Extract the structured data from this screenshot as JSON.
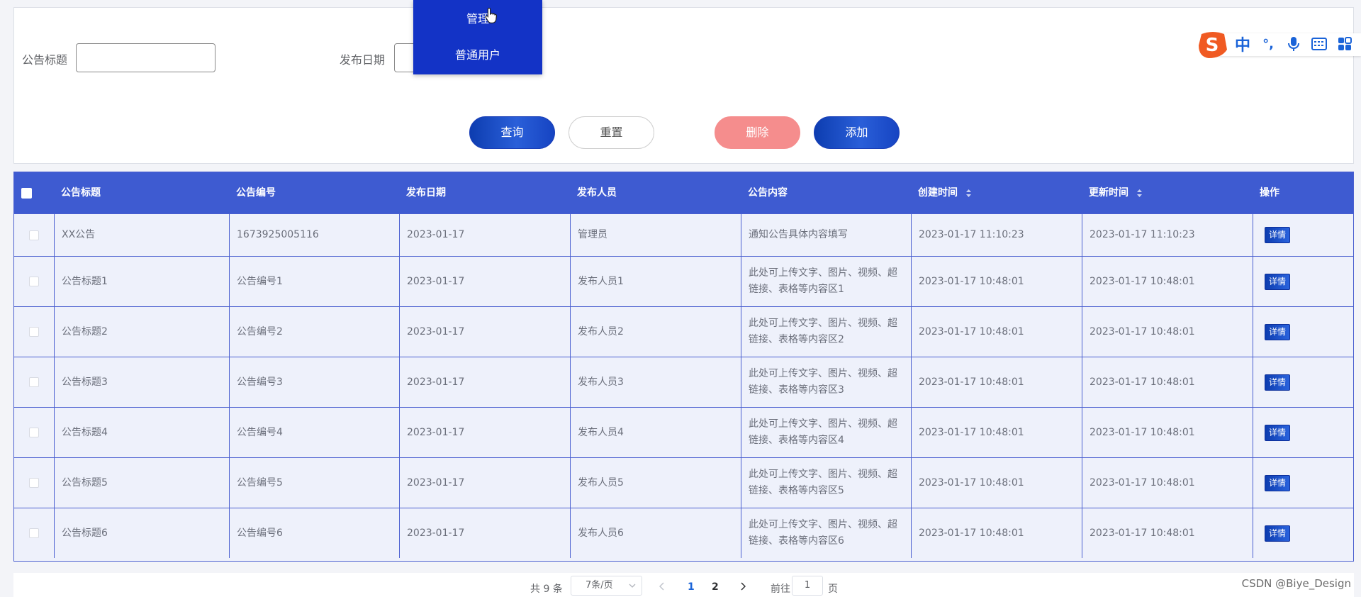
{
  "search": {
    "title_label": "公告标题",
    "title_value": "",
    "date_label": "发布日期",
    "date_value": ""
  },
  "buttons": {
    "query": "查询",
    "reset": "重置",
    "delete": "删除",
    "add": "添加"
  },
  "dropdown": {
    "items": [
      "管理员",
      "普通用户"
    ],
    "first_visible": "管理"
  },
  "ime": {
    "logo_letter": "S",
    "items": [
      "中",
      "°,",
      "mic-icon",
      "keyboard-icon",
      "grid-icon"
    ]
  },
  "table": {
    "headers": [
      "公告标题",
      "公告编号",
      "发布日期",
      "发布人员",
      "公告内容",
      "创建时间",
      "更新时间",
      "操作"
    ],
    "detail_label": "详情",
    "rows": [
      {
        "title": "XX公告",
        "number": "1673925005116",
        "date": "2023-01-17",
        "publisher": "管理员",
        "content": "通知公告具体内容填写",
        "created": "2023-01-17 11:10:23",
        "updated": "2023-01-17 11:10:23"
      },
      {
        "title": "公告标题1",
        "number": "公告编号1",
        "date": "2023-01-17",
        "publisher": "发布人员1",
        "content": "此处可上传文字、图片、视频、超链接、表格等内容区1",
        "created": "2023-01-17 10:48:01",
        "updated": "2023-01-17 10:48:01"
      },
      {
        "title": "公告标题2",
        "number": "公告编号2",
        "date": "2023-01-17",
        "publisher": "发布人员2",
        "content": "此处可上传文字、图片、视频、超链接、表格等内容区2",
        "created": "2023-01-17 10:48:01",
        "updated": "2023-01-17 10:48:01"
      },
      {
        "title": "公告标题3",
        "number": "公告编号3",
        "date": "2023-01-17",
        "publisher": "发布人员3",
        "content": "此处可上传文字、图片、视频、超链接、表格等内容区3",
        "created": "2023-01-17 10:48:01",
        "updated": "2023-01-17 10:48:01"
      },
      {
        "title": "公告标题4",
        "number": "公告编号4",
        "date": "2023-01-17",
        "publisher": "发布人员4",
        "content": "此处可上传文字、图片、视频、超链接、表格等内容区4",
        "created": "2023-01-17 10:48:01",
        "updated": "2023-01-17 10:48:01"
      },
      {
        "title": "公告标题5",
        "number": "公告编号5",
        "date": "2023-01-17",
        "publisher": "发布人员5",
        "content": "此处可上传文字、图片、视频、超链接、表格等内容区5",
        "created": "2023-01-17 10:48:01",
        "updated": "2023-01-17 10:48:01"
      },
      {
        "title": "公告标题6",
        "number": "公告编号6",
        "date": "2023-01-17",
        "publisher": "发布人员6",
        "content": "此处可上传文字、图片、视频、超链接、表格等内容区6",
        "created": "2023-01-17 10:48:01",
        "updated": "2023-01-17 10:48:01"
      }
    ]
  },
  "pager": {
    "total": "共 9 条",
    "page_size": "7条/页",
    "pages": [
      "1",
      "2"
    ],
    "current": "1",
    "goto_label": "前往",
    "goto_value": "1",
    "page_unit": "页"
  },
  "watermark": "CSDN @Biye_Design",
  "colors": {
    "header_bg": "#3e5bd1",
    "dropdown_bg": "#1333c6",
    "delete_btn": "#f58d8d",
    "row_bg": "#eef1fb",
    "active_page": "#1a63d8"
  }
}
